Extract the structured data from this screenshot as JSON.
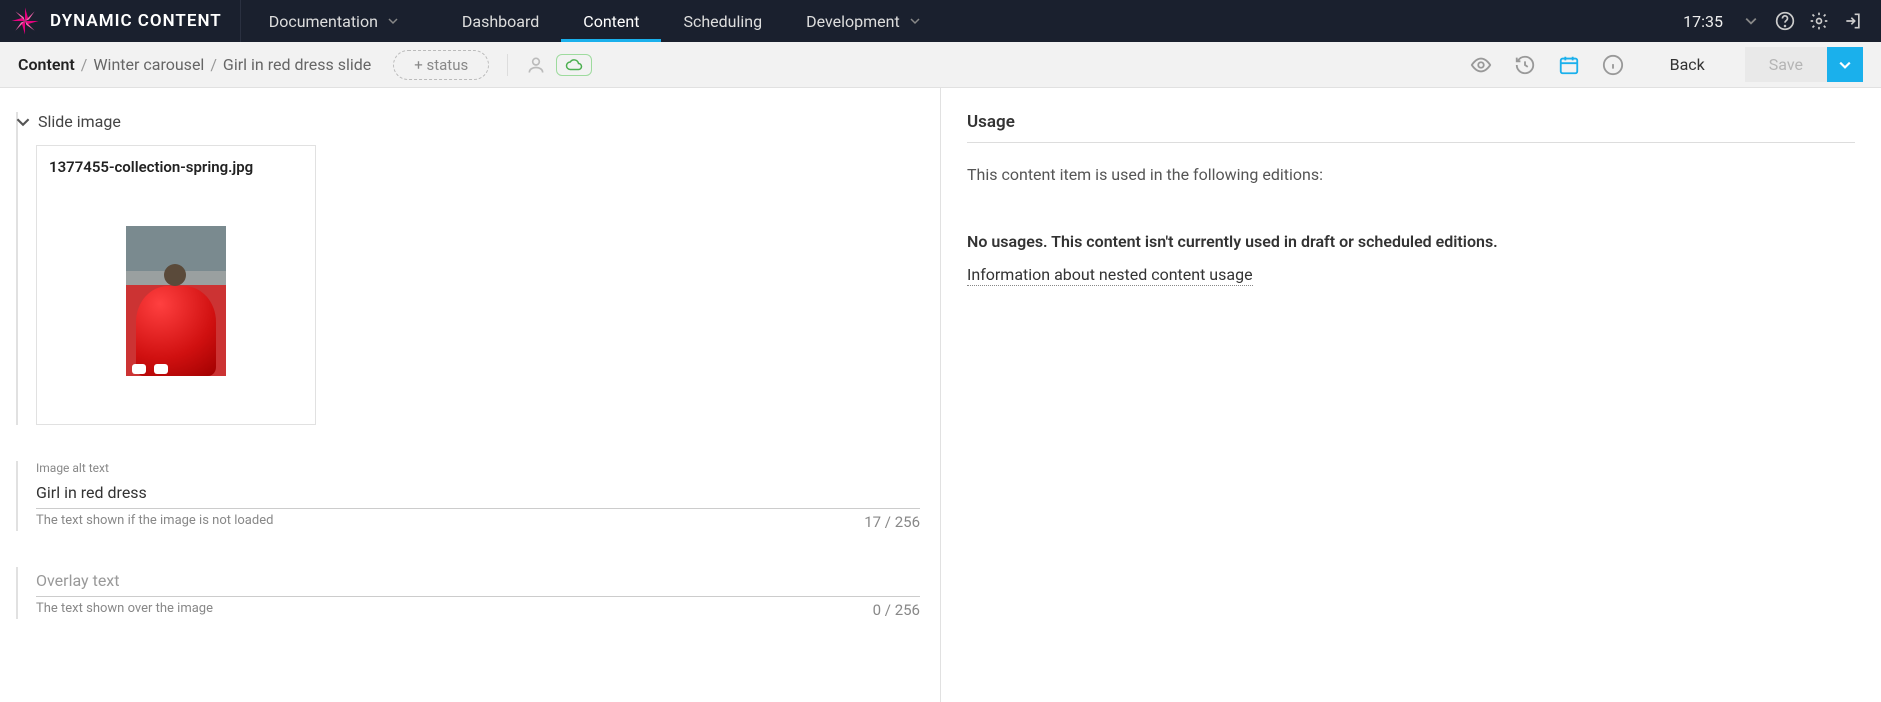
{
  "topbar": {
    "brand": "DYNAMIC CONTENT",
    "nav": {
      "documentation": "Documentation",
      "dashboard": "Dashboard",
      "content": "Content",
      "scheduling": "Scheduling",
      "development": "Development"
    },
    "time": "17:35"
  },
  "subbar": {
    "crumb1": "Content",
    "crumb2": "Winter carousel",
    "crumb3": "Girl in red dress slide",
    "status_btn": "+ status",
    "back": "Back",
    "save": "Save"
  },
  "editor": {
    "slide_image_label": "Slide image",
    "image_filename": "1377455-collection-spring.jpg",
    "alt_label": "Image alt text",
    "alt_value": "Girl in red dress",
    "alt_help": "The text shown if the image is not loaded",
    "alt_count": "17 / 256",
    "overlay_label": "Overlay text",
    "overlay_value": "",
    "overlay_help": "The text shown over the image",
    "overlay_count": "0 / 256"
  },
  "usage": {
    "title": "Usage",
    "intro": "This content item is used in the following editions:",
    "none": "No usages. This content isn't currently used in draft or scheduled editions.",
    "info_link": "Information about nested content usage"
  }
}
